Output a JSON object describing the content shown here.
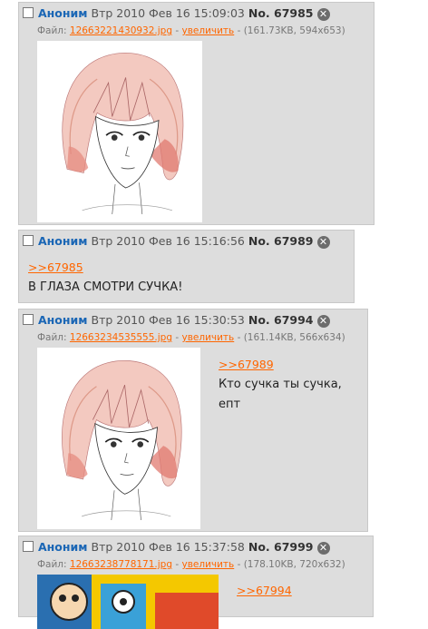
{
  "posts": [
    {
      "name": "Аноним",
      "date": "Втр 2010 Фев 16 15:09:03",
      "number": "No. 67985",
      "file_label": "Файл:",
      "filename": "12663221430932.jpg",
      "sep1": "-",
      "expand_label": "увеличить",
      "file_meta": "- (161.73KB, 594x653)",
      "delete_icon": "close-icon"
    },
    {
      "name": "Аноним",
      "date": "Втр 2010 Фев 16 15:16:56",
      "number": "No. 67989",
      "reply_link": ">>67985",
      "message": "В ГЛАЗА СМОТРИ СУЧКА!",
      "delete_icon": "close-icon"
    },
    {
      "name": "Аноним",
      "date": "Втр 2010 Фев 16 15:30:53",
      "number": "No. 67994",
      "file_label": "Файл:",
      "filename": "12663234535555.jpg",
      "sep1": "-",
      "expand_label": "увеличить",
      "file_meta": "- (161.14KB, 566x634)",
      "reply_link": ">>67989",
      "message_line1": "Кто сучка ты сучка,",
      "message_line2": "епт",
      "delete_icon": "close-icon"
    },
    {
      "name": "Аноним",
      "date": "Втр 2010 Фев 16 15:37:58",
      "number": "No. 67999",
      "file_label": "Файл:",
      "filename": "12663238778171.jpg",
      "sep1": "-",
      "expand_label": "увеличить",
      "file_meta": "- (178.10KB, 720x632)",
      "reply_link": ">>67994",
      "delete_icon": "close-icon"
    }
  ],
  "colors": {
    "post_bg": "#dddddd",
    "name": "#1a66b5",
    "link": "#ff6600"
  }
}
